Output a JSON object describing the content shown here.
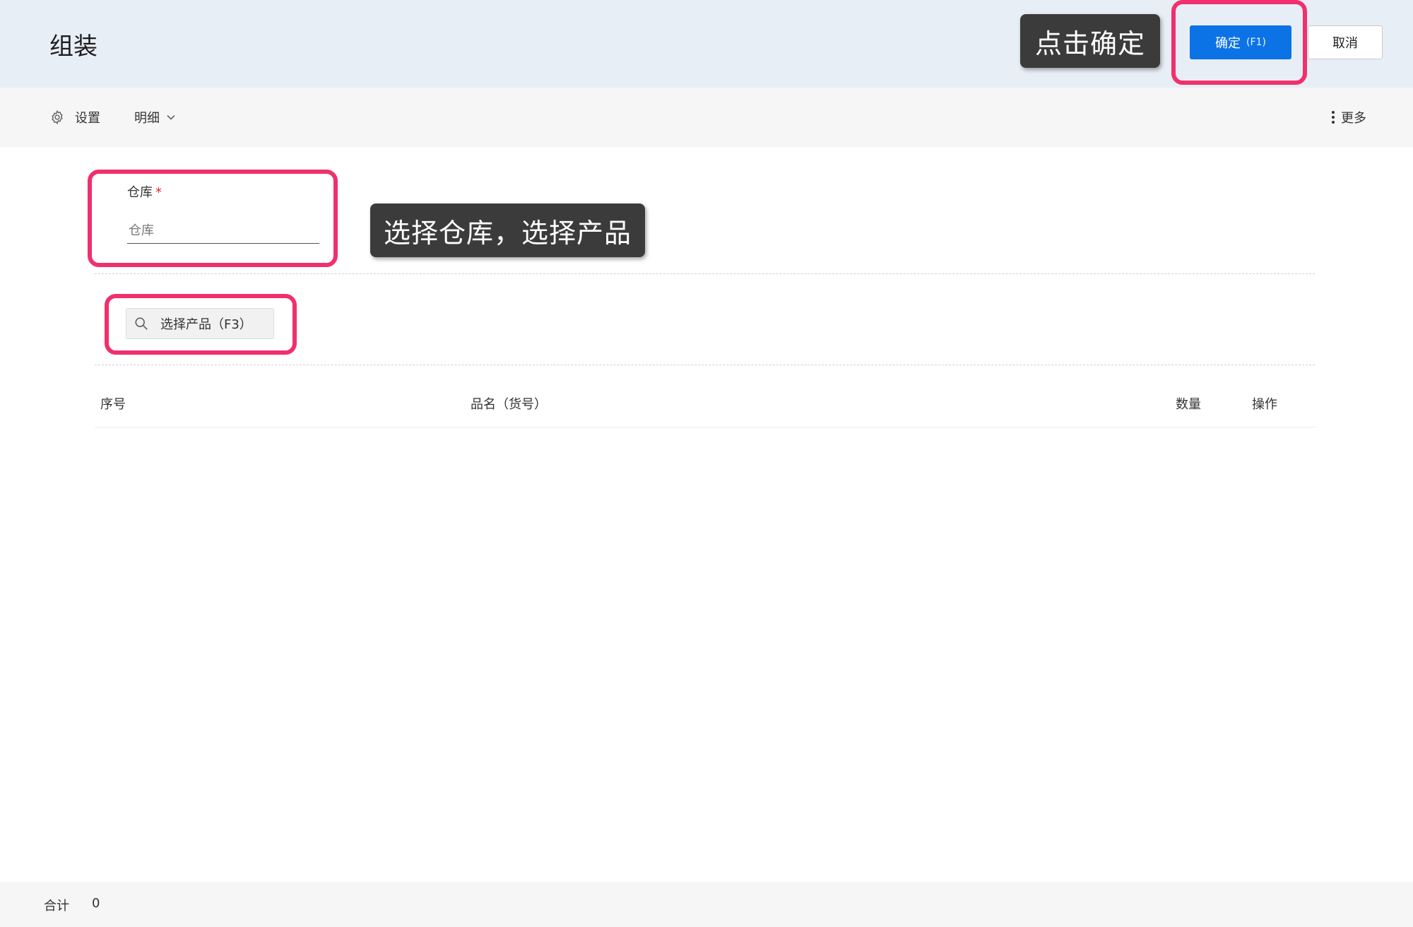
{
  "header": {
    "title": "组装",
    "confirm_label": "确定",
    "confirm_key": "(F1)",
    "cancel_label": "取消"
  },
  "toolbar": {
    "settings_label": "设置",
    "detail_label": "明细",
    "more_label": "更多"
  },
  "form": {
    "warehouse_label": "仓库",
    "warehouse_required_mark": "*",
    "warehouse_placeholder": "仓库"
  },
  "product_search": {
    "label": "选择产品（F3）"
  },
  "table": {
    "columns": [
      "序号",
      "品名（货号）",
      "数量",
      "操作"
    ],
    "rows": []
  },
  "footer": {
    "total_label": "合计",
    "total_value": "0"
  },
  "annotations": {
    "confirm_tip": "点击确定",
    "select_tip": "选择仓库，选择产品"
  },
  "colors": {
    "primary": "#0b73e6",
    "highlight": "#f0306c",
    "header_bg": "#e8eef5",
    "toolbar_bg": "#f6f6f6",
    "tooltip_bg": "#3b3b3b"
  },
  "icons": {
    "settings": "gear-icon",
    "detail": "chevron-down-icon",
    "more": "vertical-dots-icon",
    "search": "search-icon"
  }
}
